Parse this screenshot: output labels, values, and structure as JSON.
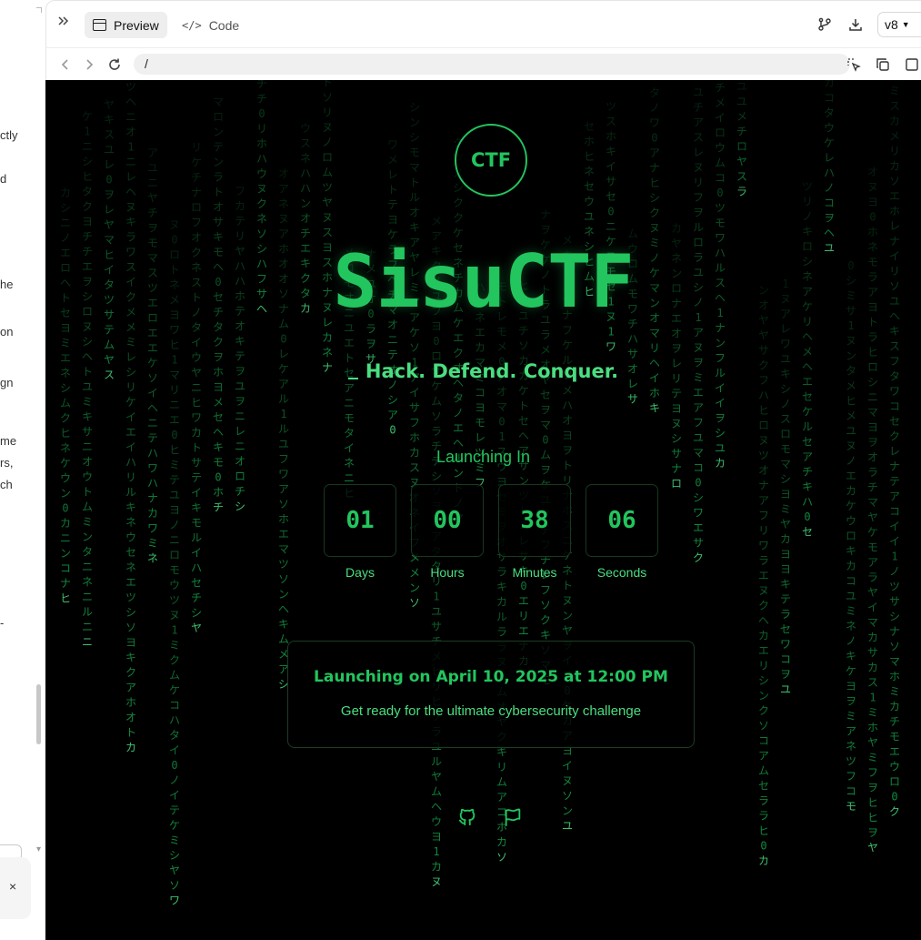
{
  "left_panel": {
    "fragments": [
      "ctly",
      "d",
      "he",
      "on",
      "gn",
      "me",
      "rs,",
      "ch",
      "-"
    ],
    "close_label": "×"
  },
  "toolbar": {
    "expand_icon": "chevrons-right-icon",
    "preview_label": "Preview",
    "code_label": "Code",
    "code_glyph": "</>",
    "version_label": "v8"
  },
  "address_bar": {
    "url": "/"
  },
  "app": {
    "logo_text": "CTF",
    "title": "SisuCTF",
    "tagline": "Hack. Defend. Conquer.",
    "launch_label": "Launching In",
    "countdown": [
      {
        "value": "01",
        "label": "Days"
      },
      {
        "value": "00",
        "label": "Hours"
      },
      {
        "value": "38",
        "label": "Minutes"
      },
      {
        "value": "06",
        "label": "Seconds"
      }
    ],
    "card_title": "Launching on April 10, 2025 at 12:00 PM",
    "card_subtitle": "Get ready for the ultimate cybersecurity challenge",
    "social_icons": [
      "github-icon",
      "flag-icon"
    ]
  },
  "colors": {
    "accent": "#22c55e",
    "accent_light": "#4ade80",
    "background": "#000000"
  }
}
